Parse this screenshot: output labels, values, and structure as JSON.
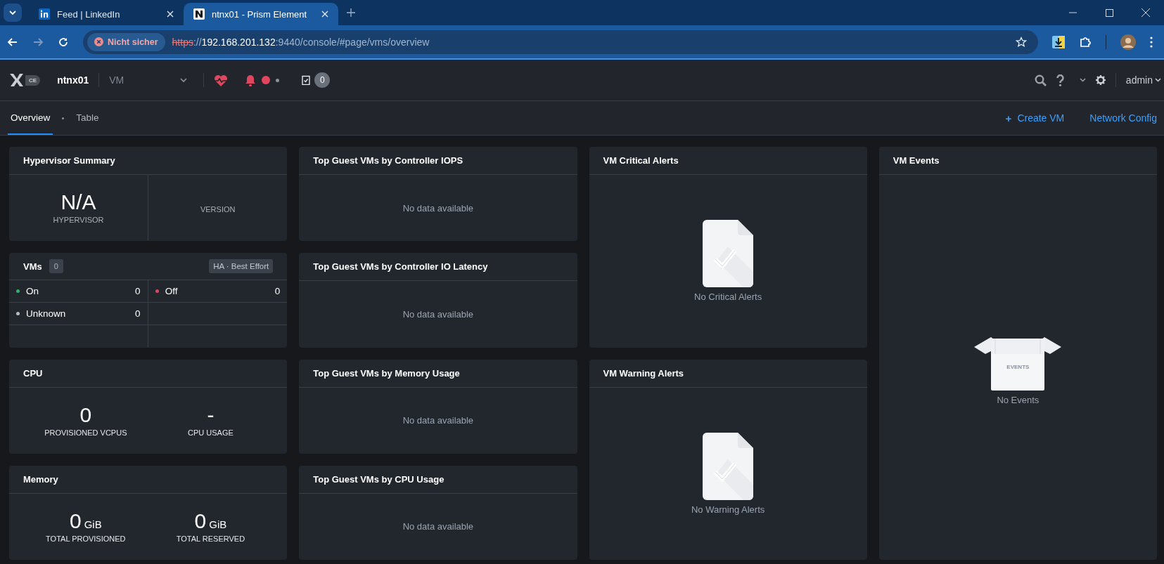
{
  "browser": {
    "tabs": [
      {
        "title": "Feed | LinkedIn",
        "kind": "linkedin",
        "selected": false
      },
      {
        "title": "ntnx01 - Prism Element",
        "kind": "nutanix",
        "selected": true
      }
    ],
    "security_label": "Nicht sicher",
    "url": {
      "scheme": "https",
      "separator": "://",
      "host": "192.168.201.132",
      "rest": ":9440/console/#page/vms/overview"
    }
  },
  "header": {
    "logo_badge": "CE",
    "cluster": "ntnx01",
    "view_selector": "VM",
    "task_count": "0",
    "user": "admin"
  },
  "subnav": {
    "tabs": [
      {
        "label": "Overview",
        "selected": true
      },
      {
        "label": "Table",
        "selected": false
      }
    ],
    "actions": [
      {
        "icon": "+",
        "label": "Create VM"
      },
      {
        "label": "Network Config"
      }
    ]
  },
  "hypervisor_summary": {
    "title": "Hypervisor Summary",
    "value": "N/A",
    "value_label": "HYPERVISOR",
    "version_label": "VERSION"
  },
  "vms": {
    "title": "VMs",
    "count": "0",
    "ha_badge": "HA · Best Effort",
    "states": [
      {
        "label": "On",
        "count": "0",
        "color": "#2fb36b"
      },
      {
        "label": "Off",
        "count": "0",
        "color": "#e0475e"
      },
      {
        "label": "Unknown",
        "count": "0",
        "color": "#b8bcc2"
      }
    ]
  },
  "cpu": {
    "title": "CPU",
    "metrics": [
      {
        "value": "0",
        "label": "PROVISIONED VCPUS"
      },
      {
        "value": "-",
        "label": "CPU USAGE"
      }
    ]
  },
  "memory": {
    "title": "Memory",
    "metrics": [
      {
        "value": "0",
        "unit": "GiB",
        "label": "TOTAL PROVISIONED"
      },
      {
        "value": "0",
        "unit": "GiB",
        "label": "TOTAL RESERVED"
      }
    ]
  },
  "top_vms": [
    {
      "title": "Top Guest VMs by Controller IOPS",
      "message": "No data available"
    },
    {
      "title": "Top Guest VMs by Controller IO Latency",
      "message": "No data available"
    },
    {
      "title": "Top Guest VMs by Memory Usage",
      "message": "No data available"
    },
    {
      "title": "Top Guest VMs by CPU Usage",
      "message": "No data available"
    }
  ],
  "alerts": [
    {
      "title": "VM Critical Alerts",
      "message": "No Critical Alerts"
    },
    {
      "title": "VM Warning Alerts",
      "message": "No Warning Alerts"
    }
  ],
  "events": {
    "title": "VM Events",
    "box_label": "EVENTS",
    "message": "No Events"
  }
}
